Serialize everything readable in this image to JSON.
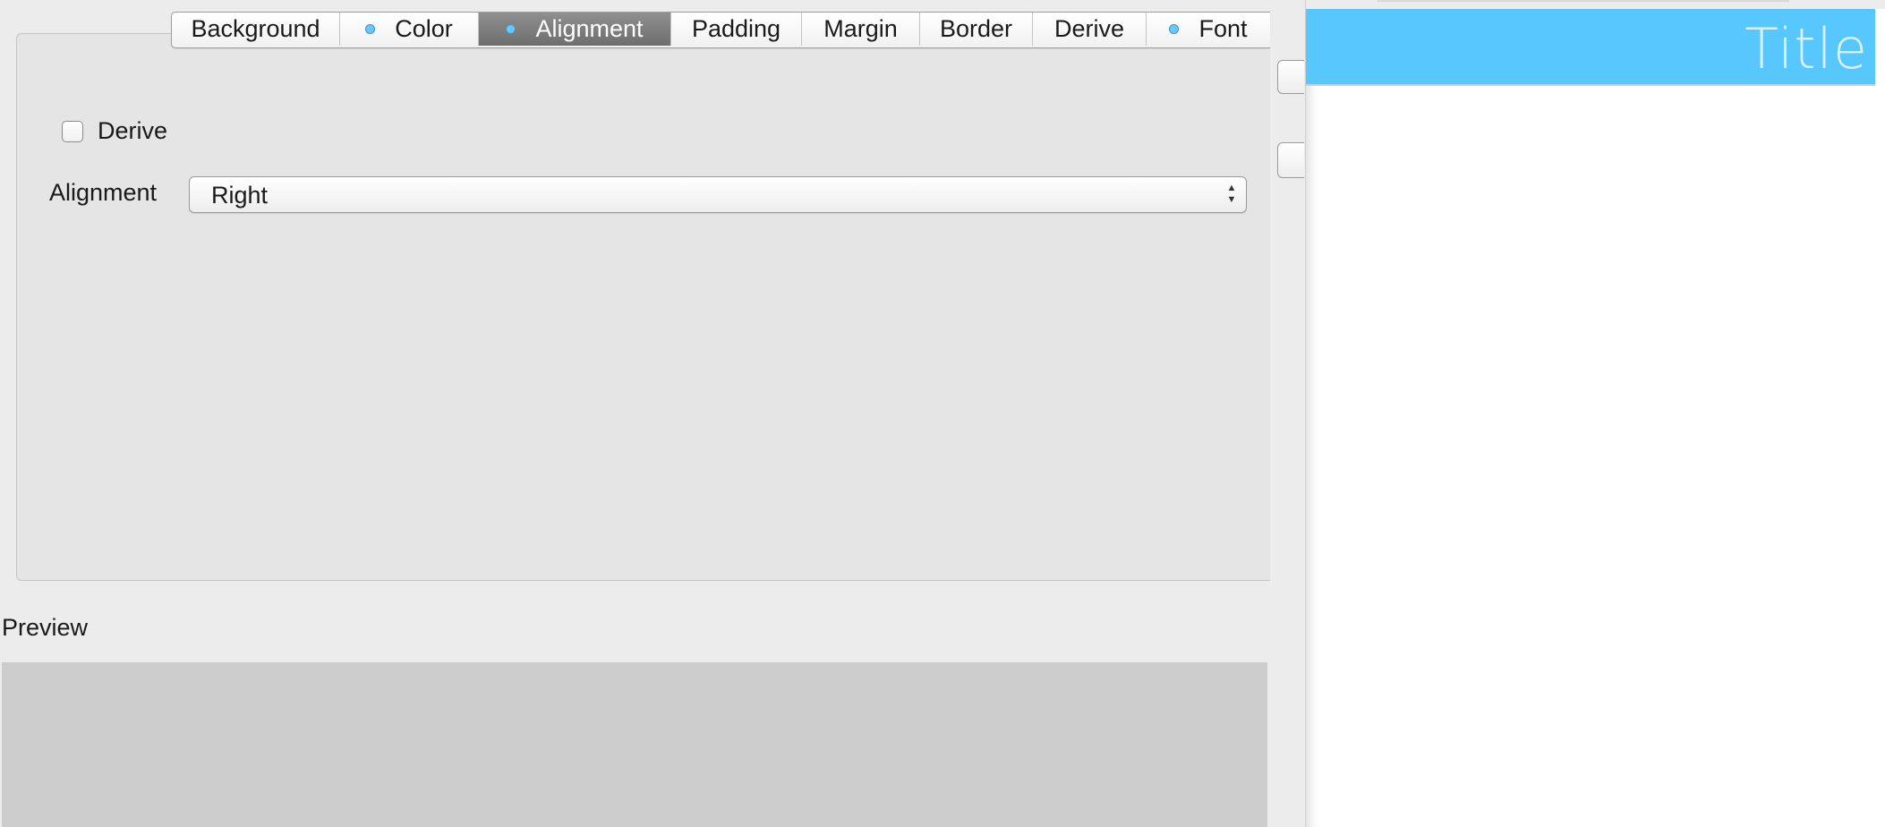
{
  "tabs": [
    {
      "label": "Background",
      "has_dot": false,
      "active": false
    },
    {
      "label": "Color",
      "has_dot": true,
      "active": false
    },
    {
      "label": "Alignment",
      "has_dot": true,
      "active": true
    },
    {
      "label": "Padding",
      "has_dot": false,
      "active": false
    },
    {
      "label": "Margin",
      "has_dot": false,
      "active": false
    },
    {
      "label": "Border",
      "has_dot": false,
      "active": false
    },
    {
      "label": "Derive",
      "has_dot": false,
      "active": false
    },
    {
      "label": "Font",
      "has_dot": true,
      "active": false
    }
  ],
  "derive": {
    "label": "Derive",
    "checked": false
  },
  "alignment": {
    "label": "Alignment",
    "value": "Right"
  },
  "preview": {
    "label": "Preview"
  },
  "right_pane": {
    "title": "Title",
    "accent_color": "#57c7fd"
  }
}
